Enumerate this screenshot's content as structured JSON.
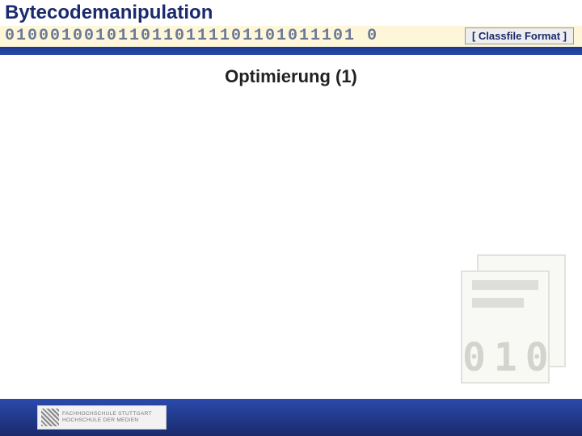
{
  "header": {
    "title": "Bytecodemanipulation",
    "binary": "0100010010110110111101101011101 0",
    "tag": "[ Classfile Format ]"
  },
  "slide": {
    "heading": "Optimierung (1)"
  },
  "graphic": {
    "digits": "010"
  },
  "footer": {
    "logo_line1": "FACHHOCHSCHULE STUTTGART",
    "logo_line2": "HOCHSCHULE DER MEDIEN"
  }
}
